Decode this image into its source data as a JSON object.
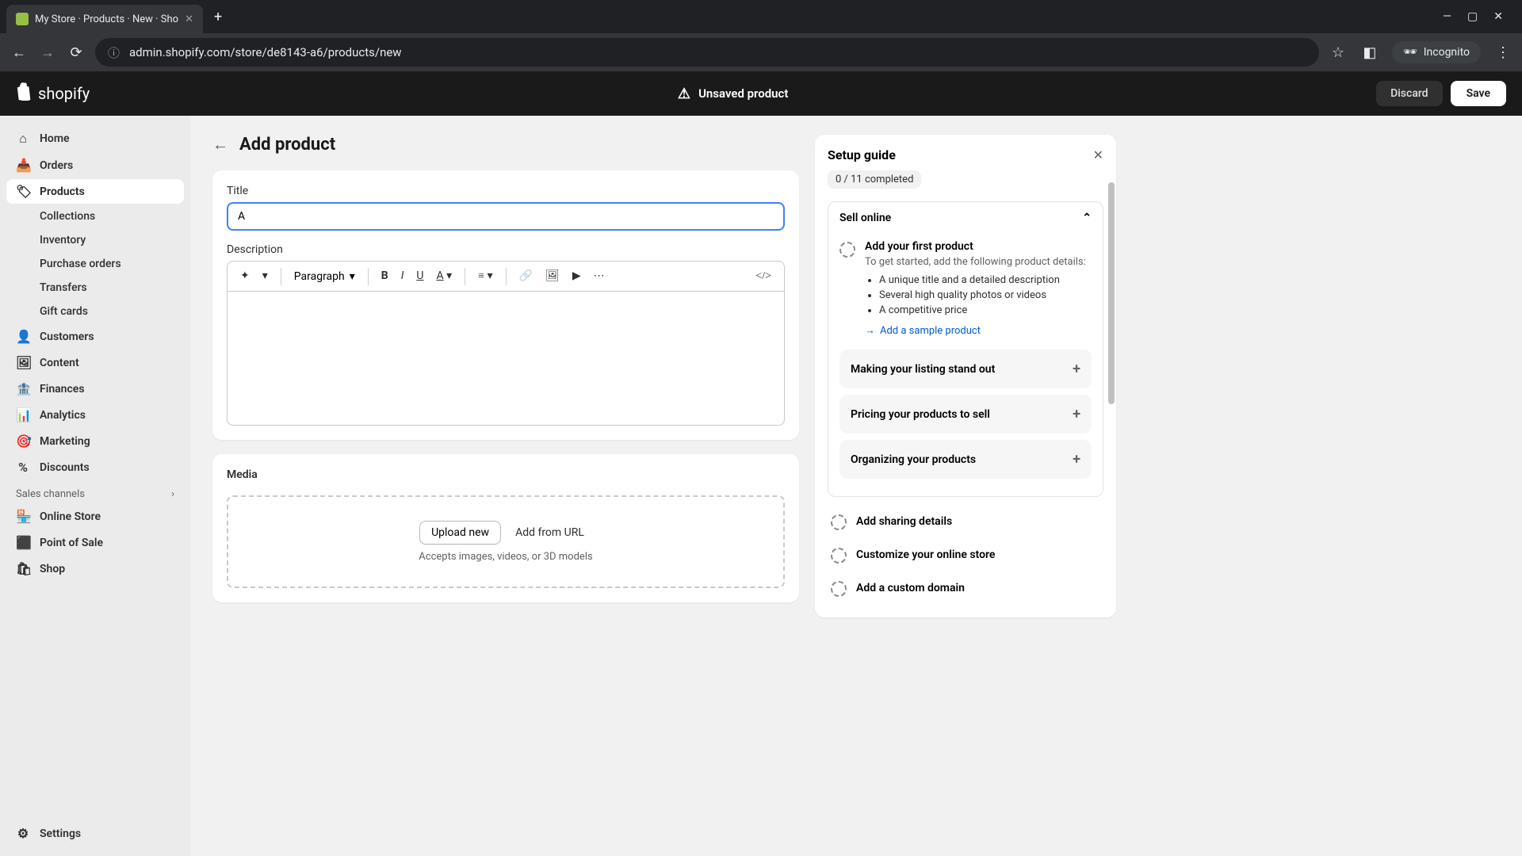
{
  "browser": {
    "tab_title": "My Store · Products · New · Sho",
    "url": "admin.shopify.com/store/de8143-a6/products/new",
    "incognito_label": "Incognito"
  },
  "header": {
    "logo_text": "shopify",
    "status_text": "Unsaved product",
    "discard_label": "Discard",
    "save_label": "Save"
  },
  "sidebar": {
    "home": "Home",
    "orders": "Orders",
    "products": "Products",
    "collections": "Collections",
    "inventory": "Inventory",
    "purchase_orders": "Purchase orders",
    "transfers": "Transfers",
    "gift_cards": "Gift cards",
    "customers": "Customers",
    "content": "Content",
    "finances": "Finances",
    "analytics": "Analytics",
    "marketing": "Marketing",
    "discounts": "Discounts",
    "sales_channels_label": "Sales channels",
    "online_store": "Online Store",
    "point_of_sale": "Point of Sale",
    "shop": "Shop",
    "settings": "Settings"
  },
  "page": {
    "title": "Add product",
    "title_label": "Title",
    "title_value": "A",
    "description_label": "Description",
    "paragraph_label": "Paragraph",
    "media_heading": "Media",
    "upload_new": "Upload new",
    "add_from_url": "Add from URL",
    "media_hint": "Accepts images, videos, or 3D models"
  },
  "setup": {
    "title": "Setup guide",
    "progress": "0 / 11 completed",
    "section_sell": "Sell online",
    "task1_title": "Add your first product",
    "task1_desc": "To get started, add the following product details:",
    "task1_item1": "A unique title and a detailed description",
    "task1_item2": "Several high quality photos or videos",
    "task1_item3": "A competitive price",
    "sample_link": "Add a sample product",
    "section_listing": "Making your listing stand out",
    "section_pricing": "Pricing your products to sell",
    "section_organizing": "Organizing your products",
    "task_sharing": "Add sharing details",
    "task_customize": "Customize your online store",
    "task_domain": "Add a custom domain"
  }
}
